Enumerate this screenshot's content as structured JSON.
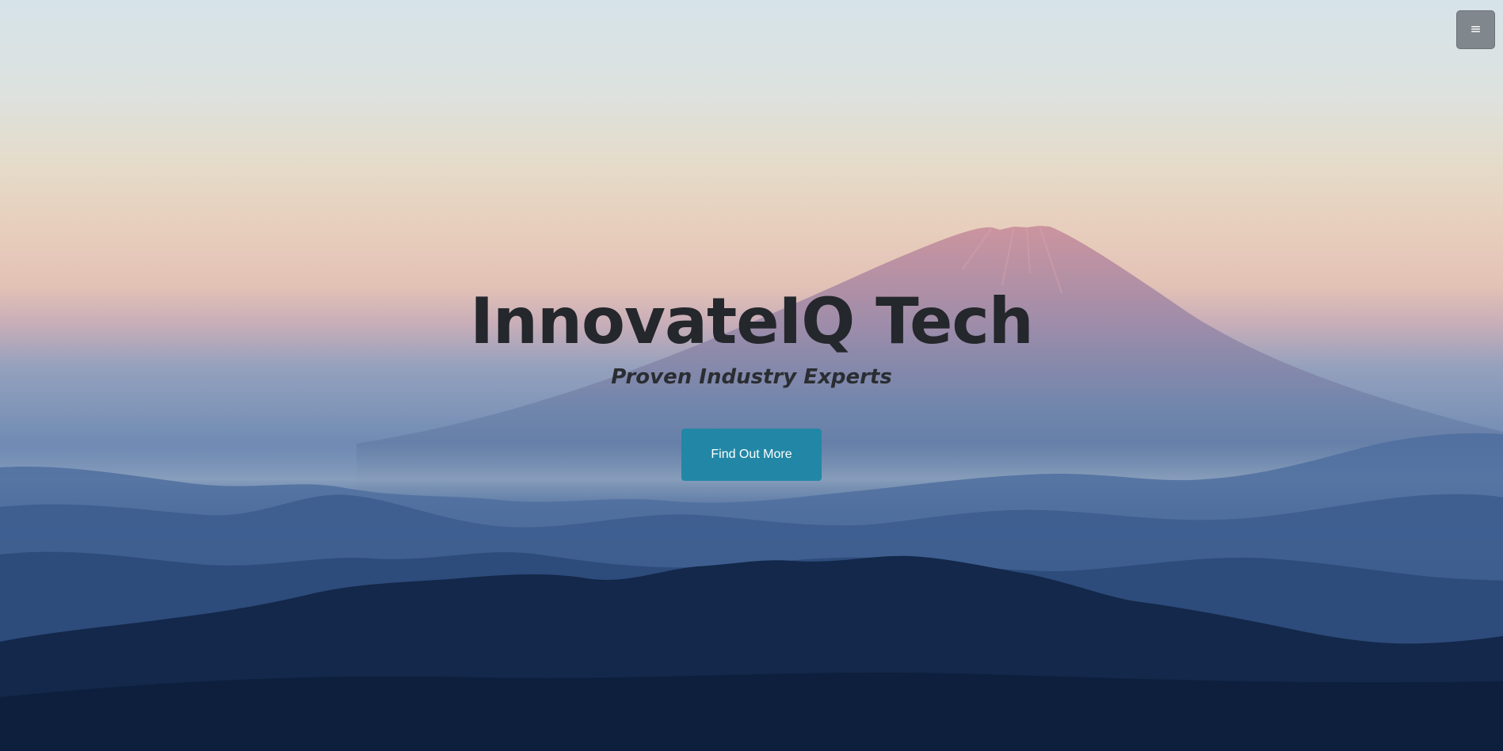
{
  "header": {
    "menu_icon": "hamburger-menu-icon",
    "menu_glyph": "≡"
  },
  "hero": {
    "background": "mountain-landscape-photo",
    "title": "InnovateIQ Tech",
    "subtitle": "Proven Industry Experts",
    "cta_label": "Find Out More"
  },
  "colors": {
    "accent": "#2287a6",
    "title_text": "#24272b",
    "menu_button": "#80878d"
  }
}
